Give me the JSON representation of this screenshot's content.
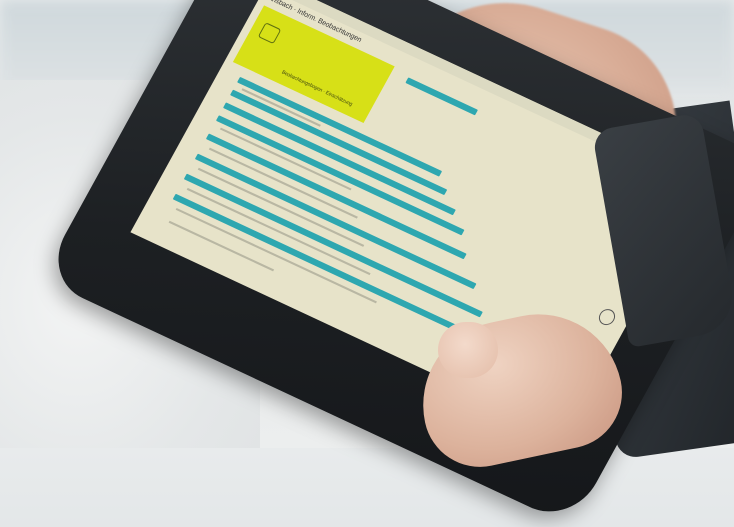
{
  "scene": {
    "description_label": "",
    "screen": {
      "app_title": "Ansbach · Inform. Beobachtungen",
      "form_title": "Beobachtungsbogen · Einschätzung"
    }
  }
}
